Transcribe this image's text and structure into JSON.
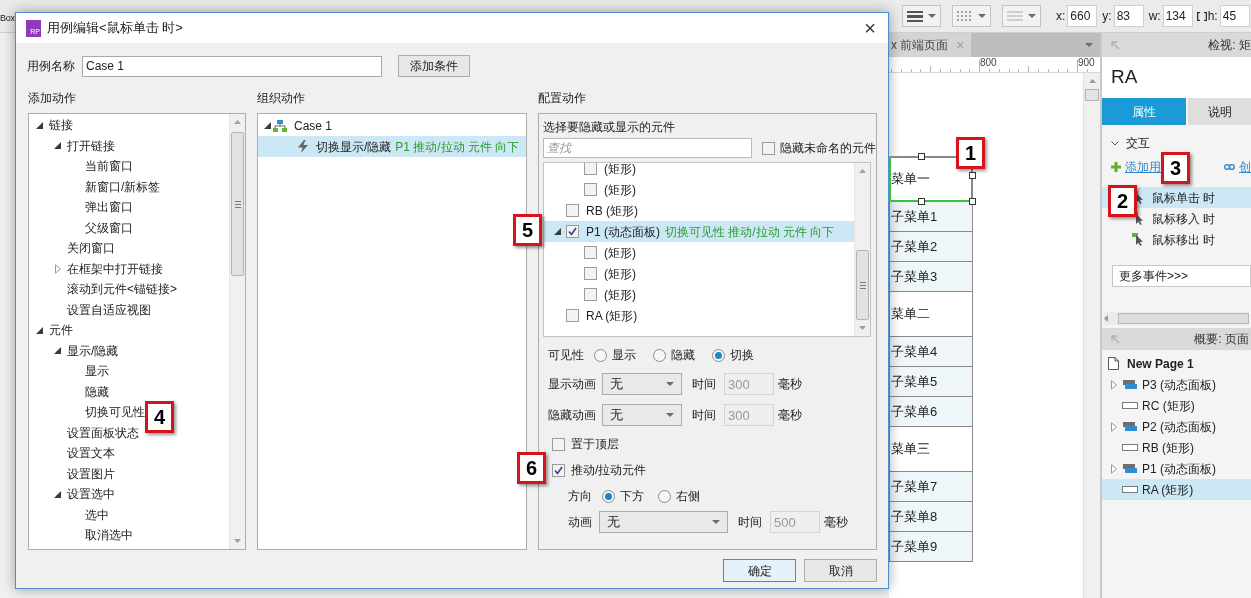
{
  "toolbar": {
    "left_field": "Box",
    "coords": [
      {
        "label": "x:",
        "value": "660"
      },
      {
        "label": "y:",
        "value": "83"
      },
      {
        "label": "w:",
        "value": "134"
      },
      {
        "label": "h:",
        "value": "45"
      }
    ]
  },
  "document_tab": {
    "label": "x 前端页面",
    "close": "×"
  },
  "ruler": {
    "labels": [
      "800",
      "900"
    ]
  },
  "canvas_widgets": [
    {
      "text": "菜单一",
      "kind": "menu",
      "selected": true
    },
    {
      "text": "子菜单1",
      "kind": "submenu",
      "selected": false
    },
    {
      "text": "子菜单2",
      "kind": "submenu",
      "selected": false
    },
    {
      "text": "子菜单3",
      "kind": "submenu",
      "selected": false
    },
    {
      "text": "菜单二",
      "kind": "menu",
      "selected": false
    },
    {
      "text": "子菜单4",
      "kind": "submenu",
      "selected": false
    },
    {
      "text": "子菜单5",
      "kind": "submenu",
      "selected": false
    },
    {
      "text": "子菜单6",
      "kind": "submenu",
      "selected": false
    },
    {
      "text": "菜单三",
      "kind": "menu",
      "selected": false
    },
    {
      "text": "子菜单7",
      "kind": "submenu",
      "selected": false
    },
    {
      "text": "子菜单8",
      "kind": "submenu",
      "selected": false
    },
    {
      "text": "子菜单9",
      "kind": "submenu",
      "selected": false
    }
  ],
  "inspector": {
    "header": "检视: 矩",
    "widget_name": "RA",
    "tabs": [
      {
        "label": "属性",
        "selected": true
      },
      {
        "label": "说明",
        "selected": false
      }
    ],
    "section": {
      "title": "交互",
      "expanded": true
    },
    "links": [
      {
        "kind": "add",
        "label": "添加用"
      },
      {
        "kind": "create",
        "label": "创"
      }
    ],
    "events": [
      {
        "label": "鼠标单击 时",
        "selected": true
      },
      {
        "label": "鼠标移入 时",
        "selected": false
      },
      {
        "label": "鼠标移出 时",
        "selected": false
      }
    ],
    "more_events": "更多事件>>>"
  },
  "outline": {
    "header": "概要: 页面",
    "items": [
      {
        "label": "New Page 1",
        "kind": "page",
        "selected": false
      },
      {
        "label": "P3 (动态面板)",
        "kind": "panel",
        "expanded": false,
        "selected": false
      },
      {
        "label": "RC (矩形)",
        "kind": "rect",
        "selected": false
      },
      {
        "label": "P2 (动态面板)",
        "kind": "panel",
        "expanded": false,
        "selected": false
      },
      {
        "label": "RB (矩形)",
        "kind": "rect",
        "selected": false
      },
      {
        "label": "P1 (动态面板)",
        "kind": "panel",
        "expanded": false,
        "selected": false
      },
      {
        "label": "RA (矩形)",
        "kind": "rect",
        "selected": true
      }
    ]
  },
  "dialog": {
    "icon_text": "RP",
    "title": "用例编辑<鼠标单击 时>",
    "close": "×",
    "case_name_label": "用例名称",
    "case_name": "Case 1",
    "add_condition": "添加条件",
    "add_actions": {
      "title": "添加动作",
      "tree": [
        {
          "label": "链接",
          "expanded": true,
          "children": [
            {
              "label": "打开链接",
              "expanded": true,
              "children": [
                {
                  "label": "当前窗口"
                },
                {
                  "label": "新窗口/新标签"
                },
                {
                  "label": "弹出窗口"
                },
                {
                  "label": "父级窗口"
                }
              ]
            },
            {
              "label": "关闭窗口"
            },
            {
              "label": "在框架中打开链接",
              "expanded": false
            },
            {
              "label": "滚动到元件<锚链接>"
            },
            {
              "label": "设置自适应视图"
            }
          ]
        },
        {
          "label": "元件",
          "expanded": true,
          "children": [
            {
              "label": "显示/隐藏",
              "expanded": true,
              "children": [
                {
                  "label": "显示"
                },
                {
                  "label": "隐藏"
                },
                {
                  "label": "切换可见性"
                }
              ]
            },
            {
              "label": "设置面板状态"
            },
            {
              "label": "设置文本"
            },
            {
              "label": "设置图片"
            },
            {
              "label": "设置选中",
              "expanded": true,
              "children": [
                {
                  "label": "选中"
                },
                {
                  "label": "取消选中"
                }
              ]
            }
          ]
        }
      ]
    },
    "organize_actions": {
      "title": "组织动作",
      "cases": [
        {
          "label": "Case 1",
          "expanded": true,
          "actions": [
            {
              "label": "切换显示/隐藏",
              "detail": "P1 推动/拉动 元件 向下",
              "selected": true
            }
          ]
        }
      ]
    },
    "configure": {
      "title": "配置动作",
      "prompt": "选择要隐藏或显示的元件",
      "search_placeholder": "查找",
      "hide_unnamed": {
        "label": "隐藏未命名的元件",
        "checked": false
      },
      "widgets": {
        "continued": [
          {
            "label": "(矩形)",
            "checked": false
          },
          {
            "label": "(矩形)",
            "checked": false
          }
        ],
        "items": [
          {
            "label": "RB (矩形)",
            "checked": false,
            "selected": false
          },
          {
            "label": "P1 (动态面板)",
            "action": "切换可见性 推动/拉动 元件 向下",
            "checked": true,
            "selected": true,
            "expanded": true,
            "children": [
              {
                "label": "(矩形)",
                "checked": false
              },
              {
                "label": "(矩形)",
                "checked": false
              },
              {
                "label": "(矩形)",
                "checked": false
              }
            ]
          },
          {
            "label": "RA (矩形)",
            "checked": false,
            "selected": false
          }
        ]
      },
      "visibility": {
        "label": "可见性",
        "options": [
          {
            "label": "显示",
            "selected": false
          },
          {
            "label": "隐藏",
            "selected": false
          },
          {
            "label": "切换",
            "selected": true
          }
        ]
      },
      "animations": [
        {
          "label": "显示动画",
          "value": "无",
          "time_label": "时间",
          "time": "300",
          "unit": "毫秒"
        },
        {
          "label": "隐藏动画",
          "value": "无",
          "time_label": "时间",
          "time": "300",
          "unit": "毫秒"
        }
      ],
      "bring_to_front": {
        "label": "置于顶层",
        "checked": false
      },
      "push_pull": {
        "label": "推动/拉动元件",
        "checked": true,
        "direction_label": "方向",
        "directions": [
          {
            "label": "下方",
            "selected": true
          },
          {
            "label": "右侧",
            "selected": false
          }
        ],
        "animation": {
          "label": "动画",
          "value": "无",
          "time_label": "时间",
          "time": "500",
          "unit": "毫秒"
        }
      }
    },
    "buttons": [
      {
        "label": "确定",
        "kind": "primary"
      },
      {
        "label": "取消",
        "kind": "secondary"
      }
    ]
  },
  "markers": [
    {
      "label": "1"
    },
    {
      "label": "2"
    },
    {
      "label": "3"
    },
    {
      "label": "4"
    },
    {
      "label": "5"
    },
    {
      "label": "6"
    }
  ]
}
